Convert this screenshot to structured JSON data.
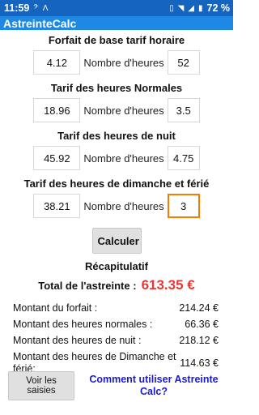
{
  "status_bar": {
    "time": "11:59",
    "battery": "72 %",
    "colors": {
      "bar": "#1565C0"
    }
  },
  "app_bar": {
    "title": "AstreinteCalc",
    "color": "#1E88E5"
  },
  "sections": [
    {
      "title": "Forfait de base tarif horaire",
      "rate": "4.12",
      "hours_label": "Nombre d'heures",
      "hours": "52"
    },
    {
      "title": "Tarif des heures Normales",
      "rate": "18.96",
      "hours_label": "Nombre d'heures",
      "hours": "3.5"
    },
    {
      "title": "Tarif des heures de nuit",
      "rate": "45.92",
      "hours_label": "Nombre d'heures",
      "hours": "4.75"
    },
    {
      "title": "Tarif des heures de dimanche et férié",
      "rate": "38.21",
      "hours_label": "Nombre d'heures",
      "hours": "3"
    }
  ],
  "calculate_label": "Calculer",
  "recap": {
    "title": "Récapitulatif",
    "total_label": "Total de l'astreinte :",
    "total_value": "613.35 €",
    "total_color": "#E53935",
    "rows": [
      {
        "label": "Montant du forfait :",
        "value": "214.24 €"
      },
      {
        "label": "Montant des heures normales :",
        "value": "66.36 €"
      },
      {
        "label": "Montant des heures de nuit :",
        "value": "218.12 €"
      },
      {
        "label": "Montant des heures de Dimanche et férié:",
        "value": "114.63 €"
      }
    ]
  },
  "footer": {
    "show_label": "Voir les saisies",
    "help_label": "Comment utiliser Astreinte Calc?",
    "link_color": "#1A1AD6"
  },
  "icons": [
    "signal-icon",
    "wifi-icon",
    "battery-icon",
    "notification-icon"
  ]
}
